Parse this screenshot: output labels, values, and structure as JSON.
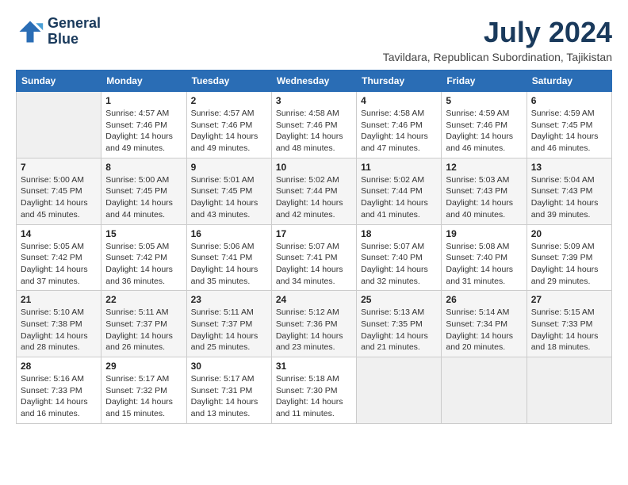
{
  "logo": {
    "line1": "General",
    "line2": "Blue"
  },
  "title": "July 2024",
  "location": "Tavildara, Republican Subordination, Tajikistan",
  "days_of_week": [
    "Sunday",
    "Monday",
    "Tuesday",
    "Wednesday",
    "Thursday",
    "Friday",
    "Saturday"
  ],
  "weeks": [
    [
      {
        "day": "",
        "info": ""
      },
      {
        "day": "1",
        "info": "Sunrise: 4:57 AM\nSunset: 7:46 PM\nDaylight: 14 hours\nand 49 minutes."
      },
      {
        "day": "2",
        "info": "Sunrise: 4:57 AM\nSunset: 7:46 PM\nDaylight: 14 hours\nand 49 minutes."
      },
      {
        "day": "3",
        "info": "Sunrise: 4:58 AM\nSunset: 7:46 PM\nDaylight: 14 hours\nand 48 minutes."
      },
      {
        "day": "4",
        "info": "Sunrise: 4:58 AM\nSunset: 7:46 PM\nDaylight: 14 hours\nand 47 minutes."
      },
      {
        "day": "5",
        "info": "Sunrise: 4:59 AM\nSunset: 7:46 PM\nDaylight: 14 hours\nand 46 minutes."
      },
      {
        "day": "6",
        "info": "Sunrise: 4:59 AM\nSunset: 7:45 PM\nDaylight: 14 hours\nand 46 minutes."
      }
    ],
    [
      {
        "day": "7",
        "info": "Sunrise: 5:00 AM\nSunset: 7:45 PM\nDaylight: 14 hours\nand 45 minutes."
      },
      {
        "day": "8",
        "info": "Sunrise: 5:00 AM\nSunset: 7:45 PM\nDaylight: 14 hours\nand 44 minutes."
      },
      {
        "day": "9",
        "info": "Sunrise: 5:01 AM\nSunset: 7:45 PM\nDaylight: 14 hours\nand 43 minutes."
      },
      {
        "day": "10",
        "info": "Sunrise: 5:02 AM\nSunset: 7:44 PM\nDaylight: 14 hours\nand 42 minutes."
      },
      {
        "day": "11",
        "info": "Sunrise: 5:02 AM\nSunset: 7:44 PM\nDaylight: 14 hours\nand 41 minutes."
      },
      {
        "day": "12",
        "info": "Sunrise: 5:03 AM\nSunset: 7:43 PM\nDaylight: 14 hours\nand 40 minutes."
      },
      {
        "day": "13",
        "info": "Sunrise: 5:04 AM\nSunset: 7:43 PM\nDaylight: 14 hours\nand 39 minutes."
      }
    ],
    [
      {
        "day": "14",
        "info": "Sunrise: 5:05 AM\nSunset: 7:42 PM\nDaylight: 14 hours\nand 37 minutes."
      },
      {
        "day": "15",
        "info": "Sunrise: 5:05 AM\nSunset: 7:42 PM\nDaylight: 14 hours\nand 36 minutes."
      },
      {
        "day": "16",
        "info": "Sunrise: 5:06 AM\nSunset: 7:41 PM\nDaylight: 14 hours\nand 35 minutes."
      },
      {
        "day": "17",
        "info": "Sunrise: 5:07 AM\nSunset: 7:41 PM\nDaylight: 14 hours\nand 34 minutes."
      },
      {
        "day": "18",
        "info": "Sunrise: 5:07 AM\nSunset: 7:40 PM\nDaylight: 14 hours\nand 32 minutes."
      },
      {
        "day": "19",
        "info": "Sunrise: 5:08 AM\nSunset: 7:40 PM\nDaylight: 14 hours\nand 31 minutes."
      },
      {
        "day": "20",
        "info": "Sunrise: 5:09 AM\nSunset: 7:39 PM\nDaylight: 14 hours\nand 29 minutes."
      }
    ],
    [
      {
        "day": "21",
        "info": "Sunrise: 5:10 AM\nSunset: 7:38 PM\nDaylight: 14 hours\nand 28 minutes."
      },
      {
        "day": "22",
        "info": "Sunrise: 5:11 AM\nSunset: 7:37 PM\nDaylight: 14 hours\nand 26 minutes."
      },
      {
        "day": "23",
        "info": "Sunrise: 5:11 AM\nSunset: 7:37 PM\nDaylight: 14 hours\nand 25 minutes."
      },
      {
        "day": "24",
        "info": "Sunrise: 5:12 AM\nSunset: 7:36 PM\nDaylight: 14 hours\nand 23 minutes."
      },
      {
        "day": "25",
        "info": "Sunrise: 5:13 AM\nSunset: 7:35 PM\nDaylight: 14 hours\nand 21 minutes."
      },
      {
        "day": "26",
        "info": "Sunrise: 5:14 AM\nSunset: 7:34 PM\nDaylight: 14 hours\nand 20 minutes."
      },
      {
        "day": "27",
        "info": "Sunrise: 5:15 AM\nSunset: 7:33 PM\nDaylight: 14 hours\nand 18 minutes."
      }
    ],
    [
      {
        "day": "28",
        "info": "Sunrise: 5:16 AM\nSunset: 7:33 PM\nDaylight: 14 hours\nand 16 minutes."
      },
      {
        "day": "29",
        "info": "Sunrise: 5:17 AM\nSunset: 7:32 PM\nDaylight: 14 hours\nand 15 minutes."
      },
      {
        "day": "30",
        "info": "Sunrise: 5:17 AM\nSunset: 7:31 PM\nDaylight: 14 hours\nand 13 minutes."
      },
      {
        "day": "31",
        "info": "Sunrise: 5:18 AM\nSunset: 7:30 PM\nDaylight: 14 hours\nand 11 minutes."
      },
      {
        "day": "",
        "info": ""
      },
      {
        "day": "",
        "info": ""
      },
      {
        "day": "",
        "info": ""
      }
    ]
  ]
}
